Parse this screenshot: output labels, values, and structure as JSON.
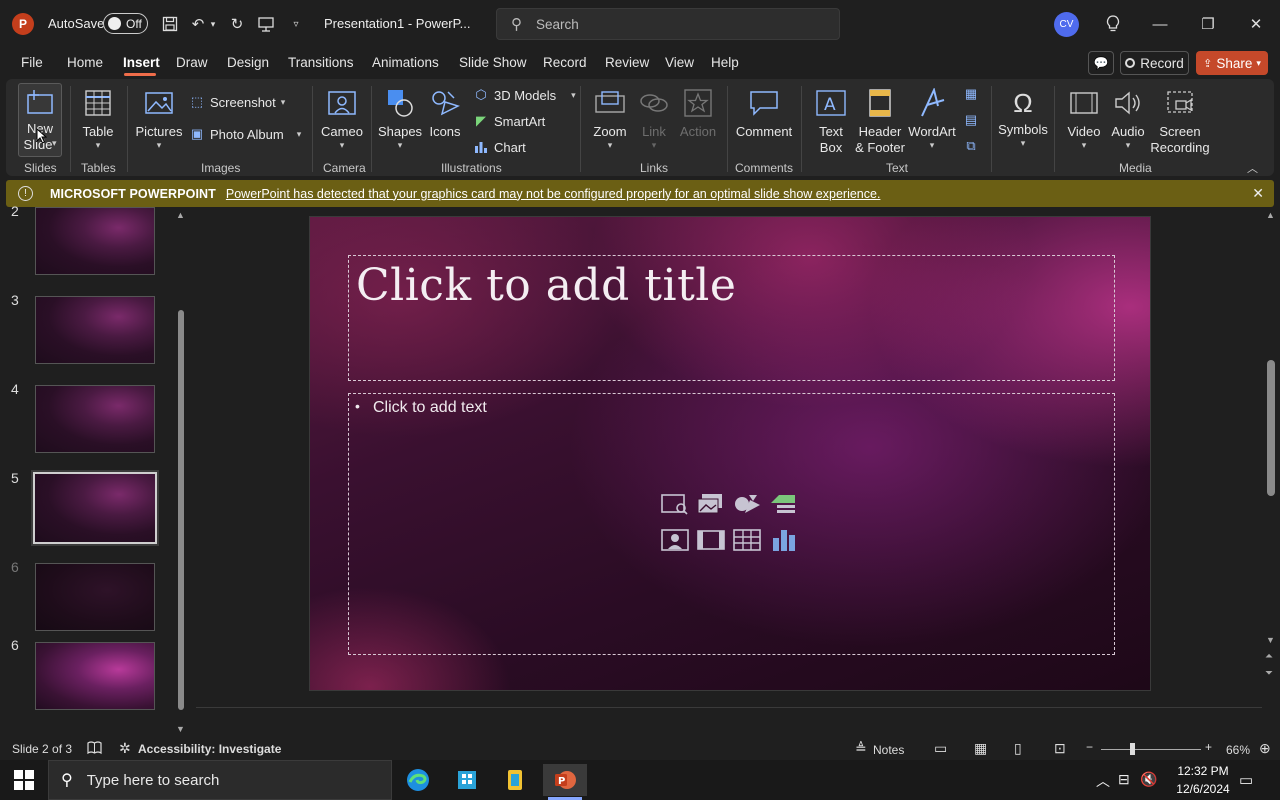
{
  "titlebar": {
    "autosave_label": "AutoSave",
    "autosave_state": "Off",
    "doc_title": "Presentation1  -  PowerP...",
    "search_placeholder": "Search",
    "avatar_initials": "CV"
  },
  "tabs": [
    "File",
    "Home",
    "Insert",
    "Draw",
    "Design",
    "Transitions",
    "Animations",
    "Slide Show",
    "Record",
    "Review",
    "View",
    "Help"
  ],
  "active_tab": "Insert",
  "actions": {
    "record": "Record",
    "share": "Share"
  },
  "ribbon": {
    "new_slide": [
      "New",
      "Slide"
    ],
    "table": "Table",
    "pictures": "Pictures",
    "screenshot": "Screenshot",
    "photo_album": "Photo Album",
    "cameo": "Cameo",
    "shapes": "Shapes",
    "icons": "Icons",
    "models_3d": "3D Models",
    "smartart": "SmartArt",
    "chart": "Chart",
    "zoom": "Zoom",
    "link": "Link",
    "action": "Action",
    "comment": "Comment",
    "text_box": [
      "Text",
      "Box"
    ],
    "header_footer": [
      "Header",
      "& Footer"
    ],
    "wordart": "WordArt",
    "symbols": "Symbols",
    "video": "Video",
    "audio": "Audio",
    "screen_recording": [
      "Screen",
      "Recording"
    ],
    "groups": [
      "Slides",
      "Tables",
      "Images",
      "Camera",
      "Illustrations",
      "Links",
      "Comments",
      "Text",
      "Media"
    ]
  },
  "warning": {
    "title": "MICROSOFT POWERPOINT",
    "message": "PowerPoint has detected that your graphics card may not be configured properly for an optimal slide show experience."
  },
  "thumbnails": [
    {
      "num": "2",
      "dim": false
    },
    {
      "num": "3",
      "dim": false
    },
    {
      "num": "4",
      "dim": false
    },
    {
      "num": "5",
      "dim": false
    },
    {
      "num": "6",
      "dim": true
    },
    {
      "num": "6",
      "dim": false
    }
  ],
  "slide": {
    "title_placeholder": "Click to add title",
    "body_placeholder": "Click to add text"
  },
  "status": {
    "slide_info": "Slide 2 of 3",
    "accessibility": "Accessibility: Investigate",
    "notes": "Notes",
    "zoom": "66%"
  },
  "taskbar": {
    "search_placeholder": "Type here to search",
    "time": "12:32 PM",
    "date": "12/6/2024"
  },
  "colors": {
    "accent": "#f06d4a",
    "share": "#c5492a",
    "warning_bg": "#6b5f14",
    "avatar": "#4f6bed"
  }
}
